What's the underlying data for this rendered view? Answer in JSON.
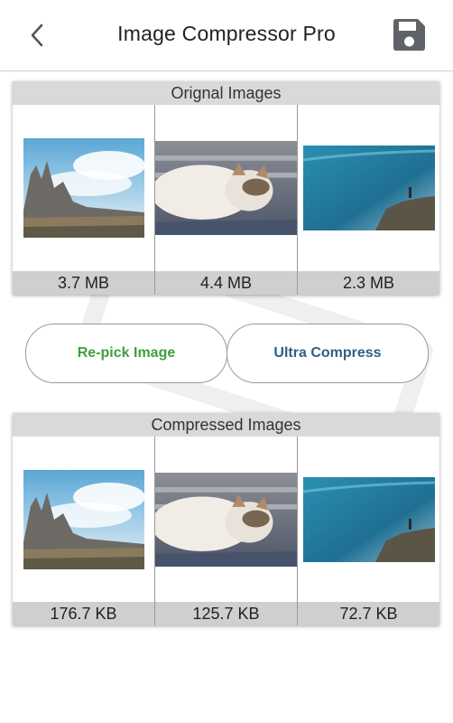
{
  "app": {
    "title": "Image Compressor Pro"
  },
  "icons": {
    "back": "chevron-left-icon",
    "save": "floppy-disk-icon"
  },
  "colors": {
    "repick": "#3f9f3f",
    "ultra": "#2f5f86",
    "panel_header_bg": "#d9d9d9"
  },
  "original": {
    "header": "Orignal Images",
    "items": [
      {
        "image": "mountain-landscape",
        "size": "3.7 MB"
      },
      {
        "image": "sleeping-cat",
        "size": "4.4 MB"
      },
      {
        "image": "sea-cliff",
        "size": "2.3 MB"
      }
    ]
  },
  "actions": {
    "repick_label": "Re-pick Image",
    "ultra_label": "Ultra Compress"
  },
  "compressed": {
    "header": "Compressed Images",
    "items": [
      {
        "image": "mountain-landscape",
        "size": "176.7 KB"
      },
      {
        "image": "sleeping-cat",
        "size": "125.7 KB"
      },
      {
        "image": "sea-cliff",
        "size": "72.7 KB"
      }
    ]
  }
}
